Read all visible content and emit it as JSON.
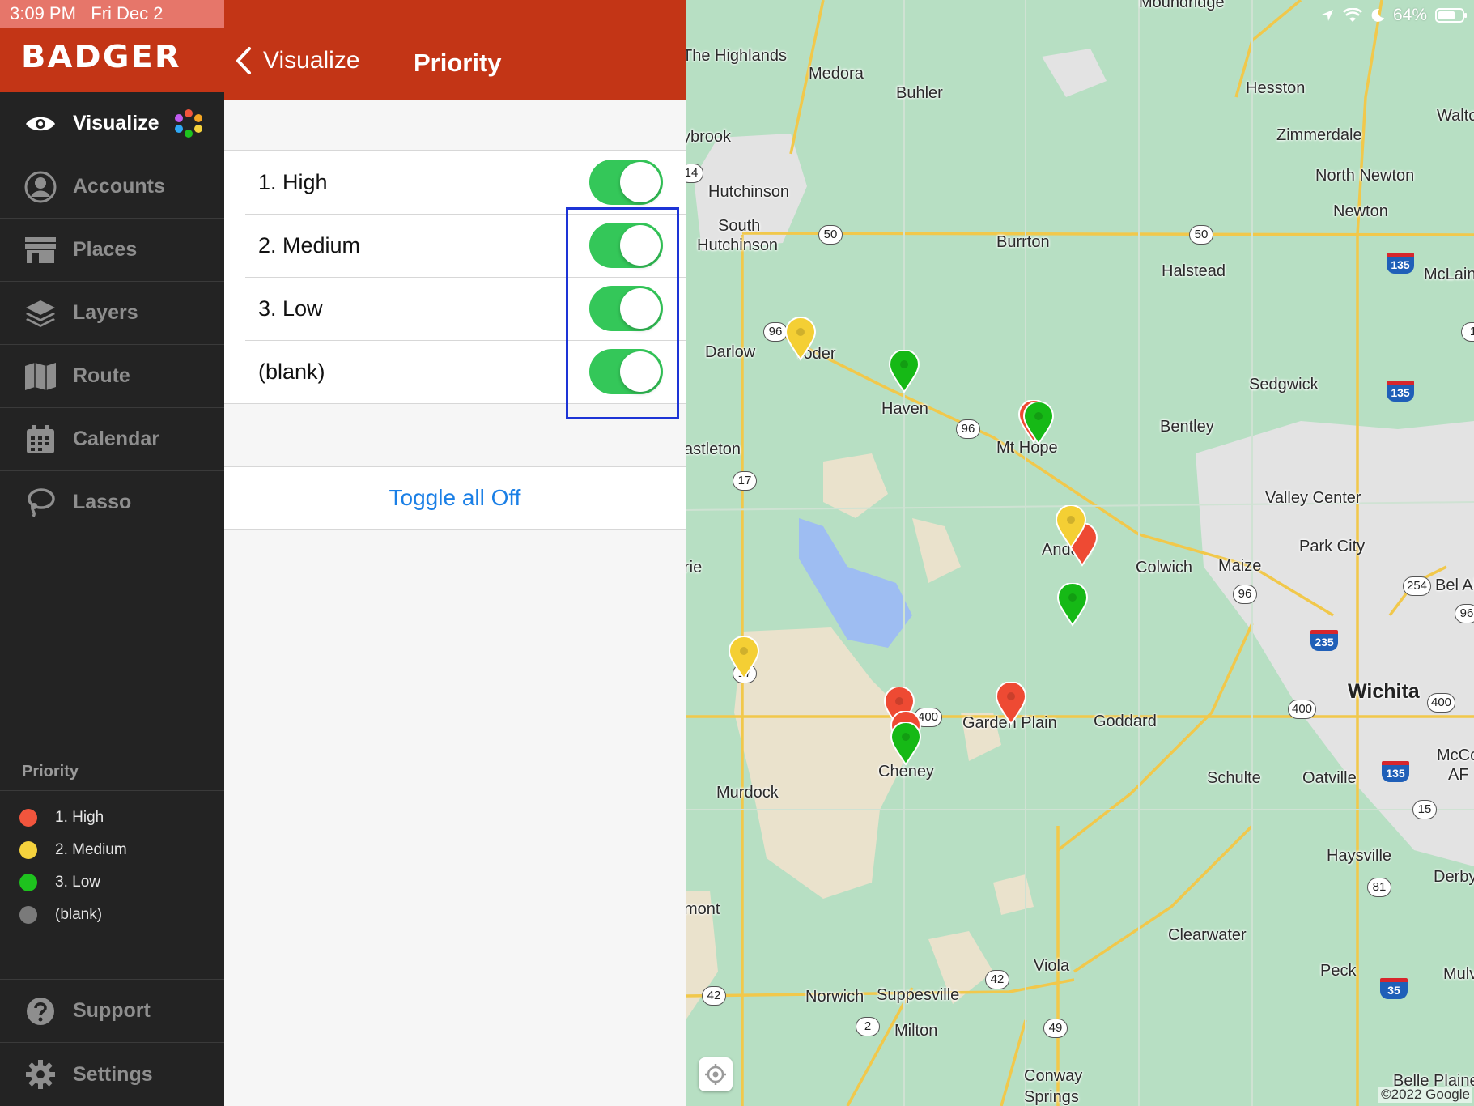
{
  "status": {
    "time": "3:09 PM",
    "date": "Fri Dec 2",
    "battery": "64%"
  },
  "brand": {
    "logo_text": "BADGER"
  },
  "sidebar": {
    "items": [
      {
        "label": "Visualize"
      },
      {
        "label": "Accounts"
      },
      {
        "label": "Places"
      },
      {
        "label": "Layers"
      },
      {
        "label": "Route"
      },
      {
        "label": "Calendar"
      },
      {
        "label": "Lasso"
      }
    ],
    "bottom": [
      {
        "label": "Support"
      },
      {
        "label": "Settings"
      }
    ]
  },
  "legend": {
    "title": "Priority",
    "items": [
      {
        "label": "1. High",
        "color": "#f2553d"
      },
      {
        "label": "2. Medium",
        "color": "#f5d23d"
      },
      {
        "label": "3. Low",
        "color": "#1ec21e"
      },
      {
        "label": "(blank)",
        "color": "#7a7a7a"
      }
    ]
  },
  "panel": {
    "back_label": "Visualize",
    "title": "Priority",
    "rows": [
      {
        "label": "1. High",
        "on": true
      },
      {
        "label": "2. Medium",
        "on": true
      },
      {
        "label": "3. Low",
        "on": true
      },
      {
        "label": "(blank)",
        "on": true
      }
    ],
    "toggle_all_label": "Toggle all Off"
  },
  "map": {
    "labels": {
      "moundridge": "Moundridge",
      "highlands": "The Highlands",
      "medora": "Medora",
      "buhler": "Buhler",
      "hesston": "Hesston",
      "walton": "Walto",
      "zimmerdale": "Zimmerdale",
      "ybrook": "ybrook",
      "north_newton": "North Newton",
      "newton": "Newton",
      "hutchinson": "Hutchinson",
      "south": "South",
      "south_hutchinson": "Hutchinson",
      "burrton": "Burrton",
      "halstead": "Halstead",
      "mclain": "McLain",
      "darlow": "Darlow",
      "yoder": "Yoder",
      "sedgwick": "Sedgwick",
      "haven": "Haven",
      "bentley": "Bentley",
      "mt_hope": "Mt Hope",
      "castleton": "astleton",
      "valley_center": "Valley Center",
      "park_city": "Park City",
      "andale": "Andale",
      "colwich": "Colwich",
      "maize": "Maize",
      "bel_aire": "Bel Air",
      "rie": "rie",
      "wichita": "Wichita",
      "garden_plain": "Garden Plain",
      "goddard": "Goddard",
      "mcconnell": "McCo",
      "afb": "AF",
      "cheney": "Cheney",
      "schulte": "Schulte",
      "oatville": "Oatville",
      "murdock": "Murdock",
      "haysville": "Haysville",
      "derby": "Derby",
      "mont": "mont",
      "clearwater": "Clearwater",
      "viola": "Viola",
      "peck": "Peck",
      "mulv": "Mulv",
      "norwich": "Norwich",
      "suppesville": "Suppesville",
      "milton": "Milton",
      "conway": "Conway",
      "springs": "Springs",
      "belle_plaine": "Belle Plaine"
    },
    "shields": {
      "us50a": "50",
      "us50b": "50",
      "k96a": "96",
      "k96b": "96",
      "k96c": "96",
      "k96d": "96",
      "k17a": "17",
      "k17b": "17",
      "us400a": "400",
      "us400b": "400",
      "us400c": "400",
      "k14": "14",
      "k42a": "42",
      "k42b": "42",
      "k2": "2",
      "k49": "49",
      "k254": "254",
      "k15": "15",
      "us81": "81",
      "k1": "1"
    },
    "interstates": {
      "i135a": "135",
      "i135b": "135",
      "i135c": "135",
      "i235": "235",
      "i35": "35"
    },
    "attribution": "©2022 Google",
    "pin_colors": {
      "high": "#ee4a33",
      "medium": "#f4cf34",
      "low": "#16b916"
    }
  }
}
